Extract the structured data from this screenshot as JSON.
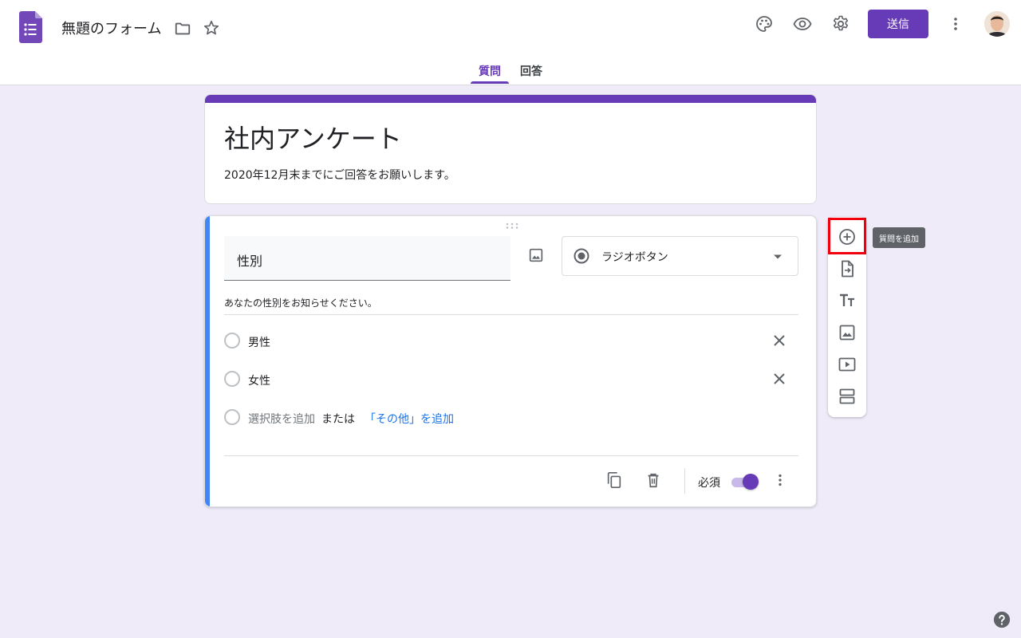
{
  "header": {
    "doc_title": "無題のフォーム",
    "send_label": "送信",
    "tabs": [
      {
        "label": "質問",
        "active": true
      },
      {
        "label": "回答",
        "active": false
      }
    ]
  },
  "title_card": {
    "title": "社内アンケート",
    "description": "2020年12月末までにご回答をお願いします。"
  },
  "question": {
    "title": "性別",
    "type_label": "ラジオボタン",
    "description": "あなたの性別をお知らせください。",
    "options": [
      {
        "label": "男性"
      },
      {
        "label": "女性"
      }
    ],
    "add_option_label": "選択肢を追加",
    "or_label": "または",
    "add_other_label": "「その他」を追加",
    "required_label": "必須",
    "required": true
  },
  "toolbar": {
    "tooltip": "質問を追加"
  },
  "colors": {
    "accent": "#673ab7",
    "background": "#efebf9",
    "card_highlight": "#4285f4",
    "callout": "#f0000f",
    "link": "#1a73e8"
  }
}
